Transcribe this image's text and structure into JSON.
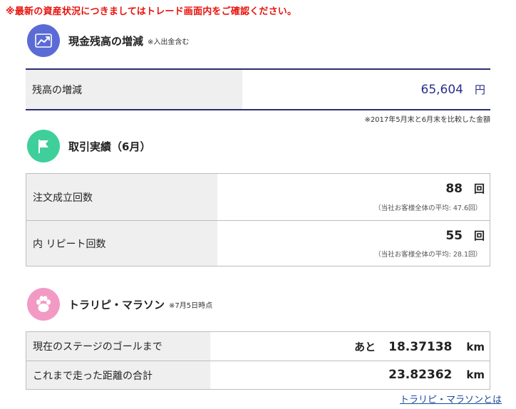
{
  "notice": "※最新の資産状況につきましてはトレード画面内をご確認ください。",
  "cash": {
    "title": "現金残高の増減",
    "note": "※入出金含む",
    "label": "残高の増減",
    "value": "65,604",
    "unit": "円",
    "footnote": "※2017年5月末と6月末を比較した金額",
    "icon": "trend-chart-icon",
    "icon_color": "#5b6bd6",
    "value_color": "#2a2f8a"
  },
  "trades": {
    "title": "取引実績（6月）",
    "icon": "flag-icon",
    "icon_color": "#3fcf9a",
    "rows": [
      {
        "label": "注文成立回数",
        "value": "88",
        "unit": "回",
        "sub": "（当社お客様全体の平均: 47.6回）"
      },
      {
        "label": "内 リピート回数",
        "value": "55",
        "unit": "回",
        "sub": "（当社お客様全体の平均: 28.1回）"
      }
    ]
  },
  "marathon": {
    "title": "トラリピ・マラソン",
    "note": "※7月5日時点",
    "icon": "paw-icon",
    "icon_color": "#f29ac4",
    "rows": [
      {
        "label": "現在のステージのゴールまで",
        "prefix": "あと",
        "value": "18.37138",
        "unit": "km"
      },
      {
        "label": "これまで走った距離の合計",
        "prefix": "",
        "value": "23.82362",
        "unit": "km"
      }
    ],
    "link": "トラリピ・マラソンとは"
  }
}
